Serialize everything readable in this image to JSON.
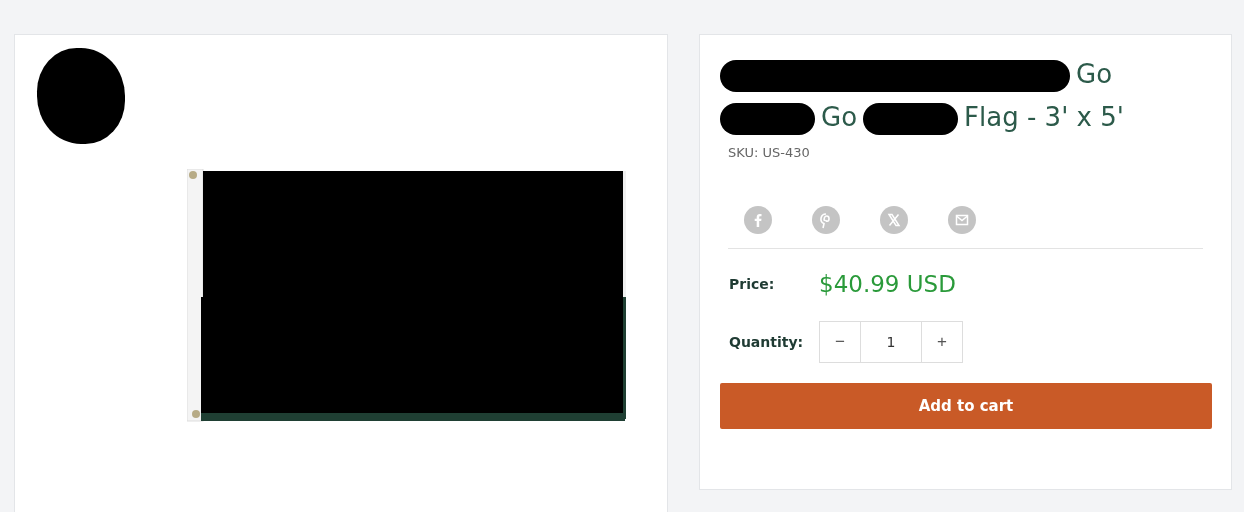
{
  "title_parts": [
    {
      "kind": "redacted"
    },
    {
      "kind": "text",
      "text": "Go"
    },
    {
      "kind": "break"
    },
    {
      "kind": "redacted"
    },
    {
      "kind": "text",
      "text": "Go"
    },
    {
      "kind": "redacted"
    },
    {
      "kind": "text",
      "text": "Flag - 3' x 5'"
    }
  ],
  "sku": "SKU: US-430",
  "share_icons": [
    {
      "kind": "facebook"
    },
    {
      "kind": "pinterest"
    },
    {
      "kind": "x"
    },
    {
      "kind": "email"
    }
  ],
  "price": {
    "label": "Price:",
    "value": "$40.99 USD"
  },
  "quantity": {
    "label": "Quantity:",
    "minus": "−",
    "value": "1",
    "plus": "+"
  },
  "add_to_cart": "Add to cart"
}
